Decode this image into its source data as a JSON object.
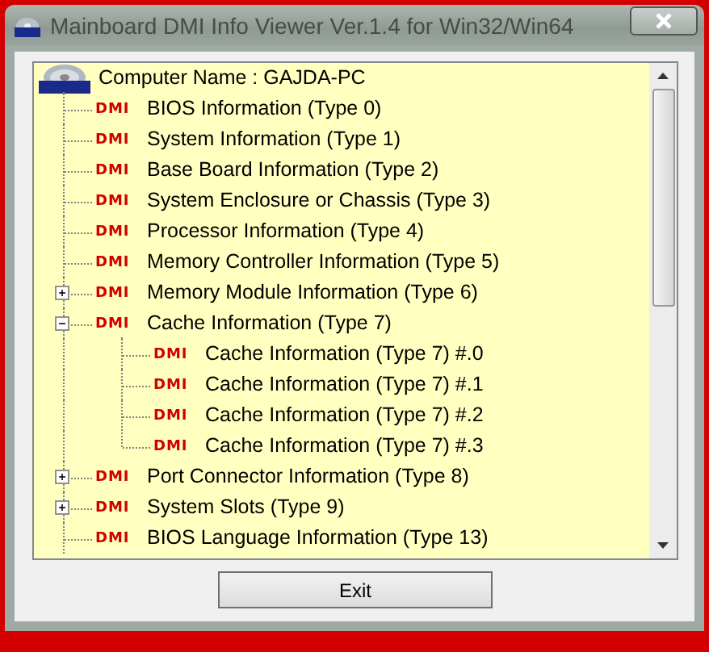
{
  "window": {
    "title": "Mainboard DMI Info Viewer Ver.1.4 for Win32/Win64"
  },
  "tree": {
    "root": {
      "label": "Computer Name : GAJDA-PC",
      "children": [
        {
          "kind": "leaf",
          "tag": "DMI",
          "label": "BIOS Information (Type 0)"
        },
        {
          "kind": "leaf",
          "tag": "DMI",
          "label": "System Information (Type 1)"
        },
        {
          "kind": "leaf",
          "tag": "DMI",
          "label": "Base Board Information (Type 2)"
        },
        {
          "kind": "leaf",
          "tag": "DMI",
          "label": "System Enclosure or Chassis (Type 3)"
        },
        {
          "kind": "leaf",
          "tag": "DMI",
          "label": "Processor Information (Type 4)"
        },
        {
          "kind": "leaf",
          "tag": "DMI",
          "label": "Memory Controller Information (Type 5)"
        },
        {
          "kind": "group",
          "expanded": false,
          "tag": "DMI",
          "label": "Memory Module Information (Type 6)"
        },
        {
          "kind": "group",
          "expanded": true,
          "tag": "DMI",
          "label": "Cache Information (Type 7)",
          "children": [
            {
              "kind": "leaf",
              "tag": "DMI",
              "label": "Cache Information (Type 7) #.0"
            },
            {
              "kind": "leaf",
              "tag": "DMI",
              "label": "Cache Information (Type 7) #.1"
            },
            {
              "kind": "leaf",
              "tag": "DMI",
              "label": "Cache Information (Type 7) #.2"
            },
            {
              "kind": "leaf",
              "tag": "DMI",
              "label": "Cache Information (Type 7) #.3"
            }
          ]
        },
        {
          "kind": "group",
          "expanded": false,
          "tag": "DMI",
          "label": "Port Connector Information (Type 8)"
        },
        {
          "kind": "group",
          "expanded": false,
          "tag": "DMI",
          "label": "System Slots (Type 9)"
        },
        {
          "kind": "leaf",
          "tag": "DMI",
          "label": "BIOS Language Information (Type 13)"
        }
      ]
    }
  },
  "buttons": [
    {
      "label": "Exit"
    }
  ]
}
